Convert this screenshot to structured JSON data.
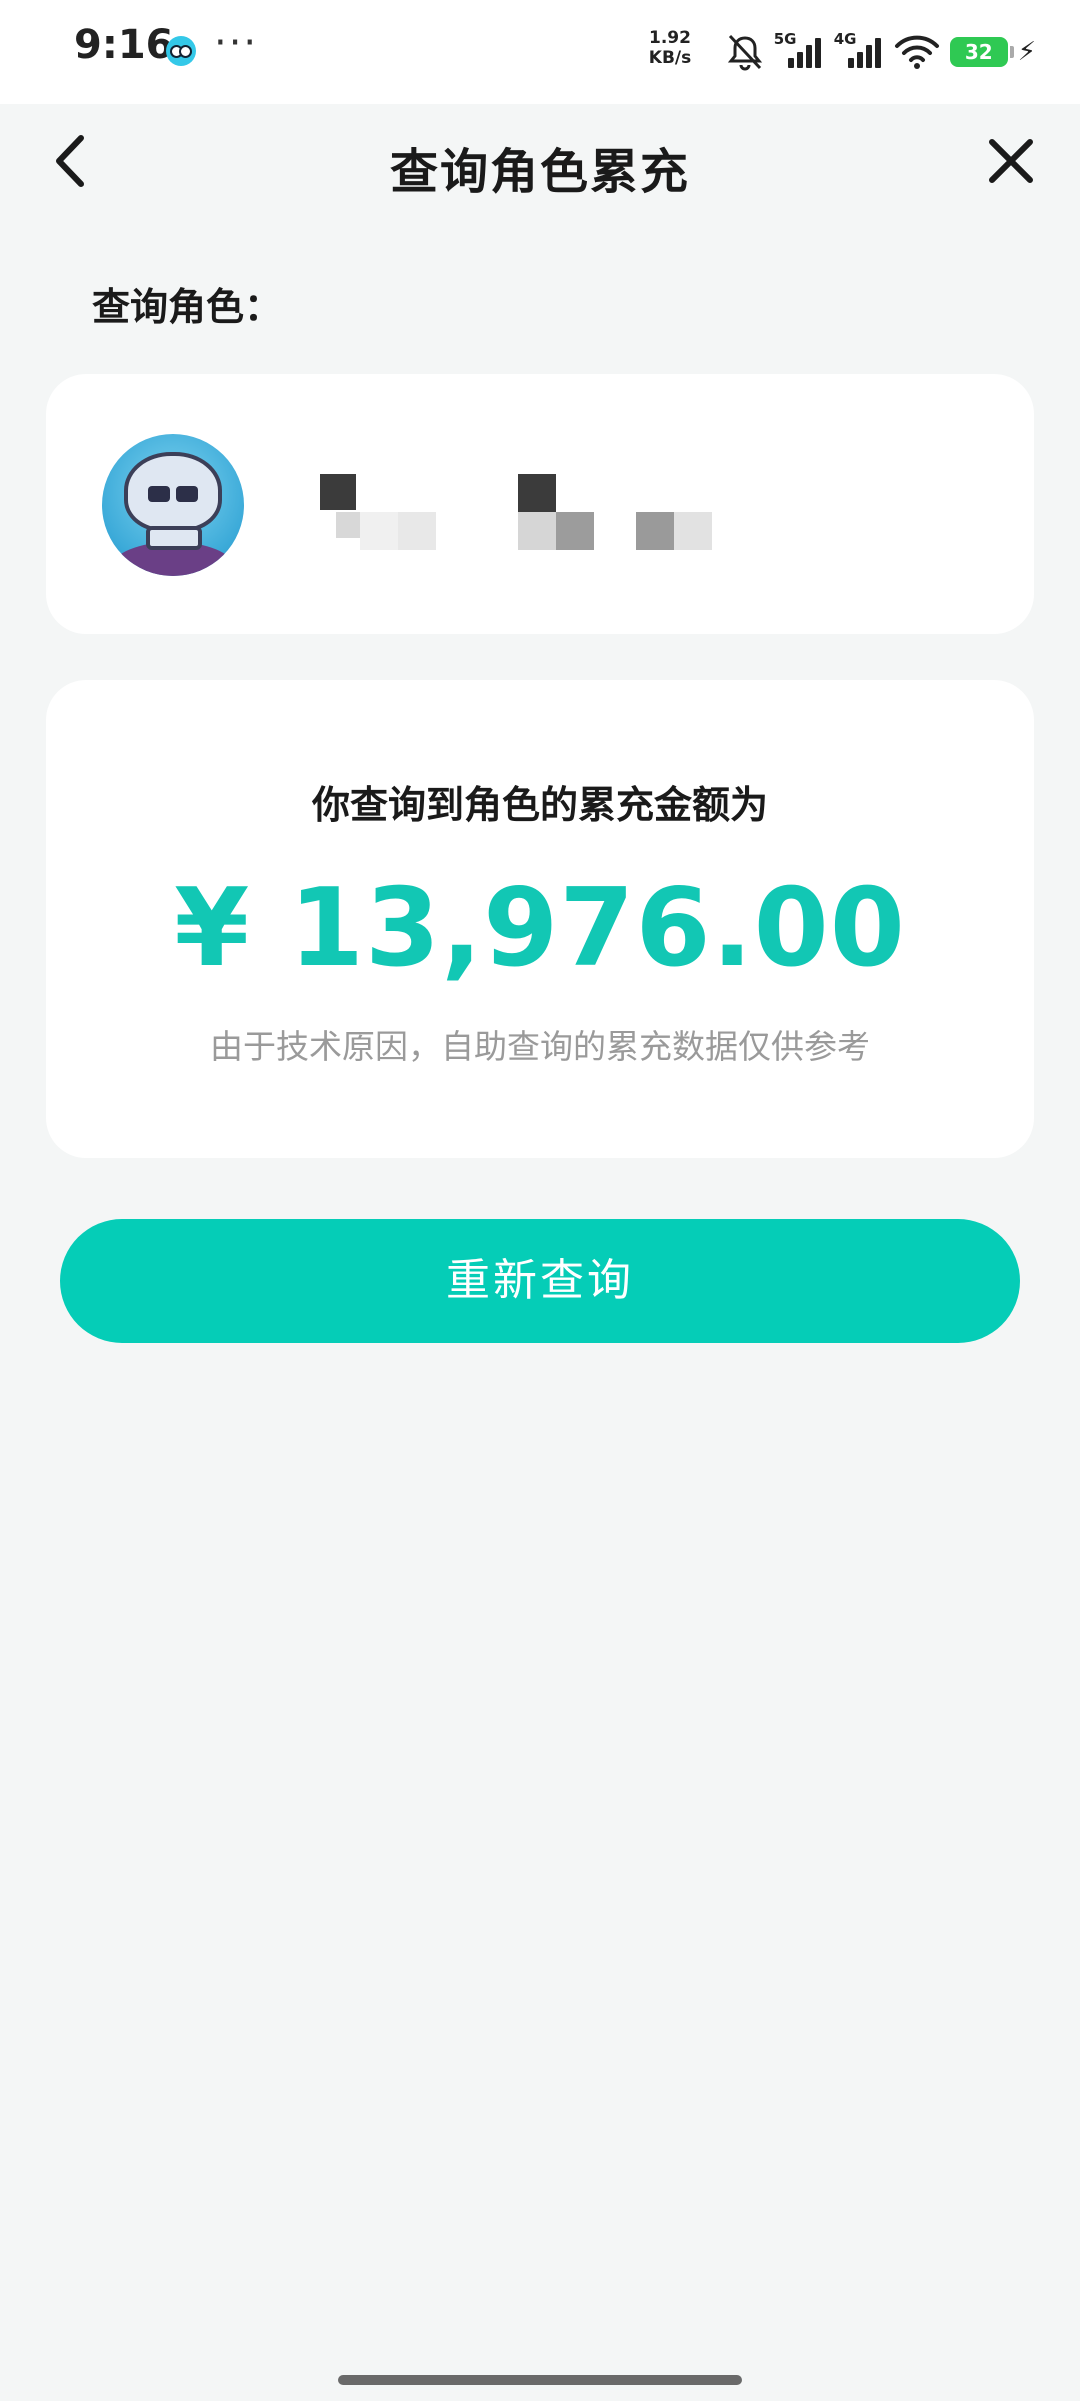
{
  "status_bar": {
    "time": "9:16",
    "dots": "···",
    "net_speed_value": "1.92",
    "net_speed_unit": "KB/s",
    "signal1_label": "5G",
    "signal2_label": "4G",
    "battery": "32",
    "icons": [
      "app-notification-icon",
      "mute-bell-icon",
      "signal-icon",
      "wifi-icon",
      "battery-icon",
      "charging-icon"
    ]
  },
  "header": {
    "title": "查询角色累充",
    "back_icon": "chevron-left-icon",
    "close_icon": "close-icon"
  },
  "section_label": "查询角色：",
  "role_card": {
    "avatar_icon": "skull-avatar",
    "name_obscured": true
  },
  "amount_card": {
    "caption": "你查询到角色的累充金额为",
    "amount": "¥ 13,976.00",
    "note": "由于技术原因，自助查询的累充数据仅供参考"
  },
  "requery_button": "重新查询",
  "colors": {
    "accent": "#05cdb7",
    "amount_text": "#12c7b4",
    "background": "#f4f6f6",
    "card": "#ffffff",
    "note_text": "#9a9a9a"
  }
}
